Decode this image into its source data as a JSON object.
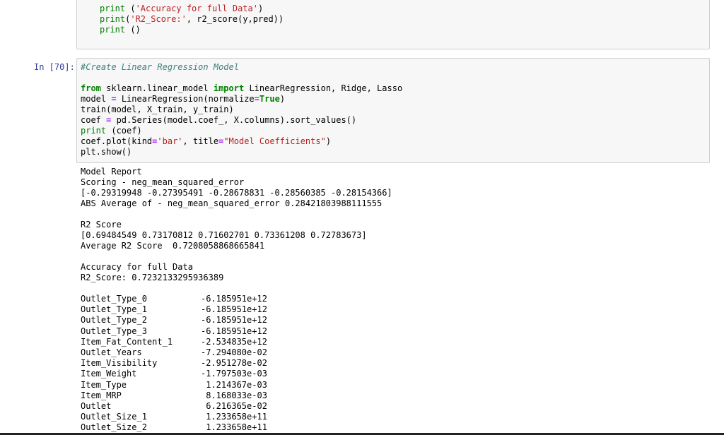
{
  "cell_prev": {
    "lines": [
      [
        {
          "t": "print",
          "c": "bi"
        },
        {
          "t": " (",
          "c": ""
        },
        {
          "t": "'Accuracy for full Data'",
          "c": "str"
        },
        {
          "t": ")",
          "c": ""
        }
      ],
      [
        {
          "t": "print",
          "c": "bi"
        },
        {
          "t": "(",
          "c": ""
        },
        {
          "t": "'R2_Score:'",
          "c": "str"
        },
        {
          "t": ", r2_score(y,pred))",
          "c": ""
        }
      ],
      [
        {
          "t": "print",
          "c": "bi"
        },
        {
          "t": " ()",
          "c": ""
        }
      ]
    ]
  },
  "cell70": {
    "prompt": "In [70]:",
    "lines": [
      [
        {
          "t": "#Create Linear Regression Model",
          "c": "cm"
        }
      ],
      [
        {
          "t": "",
          "c": ""
        }
      ],
      [
        {
          "t": "from",
          "c": "kw"
        },
        {
          "t": " sklearn.linear_model ",
          "c": ""
        },
        {
          "t": "import",
          "c": "kw"
        },
        {
          "t": " LinearRegression, Ridge, Lasso",
          "c": ""
        }
      ],
      [
        {
          "t": "model ",
          "c": ""
        },
        {
          "t": "=",
          "c": "op"
        },
        {
          "t": " LinearRegression(normalize",
          "c": ""
        },
        {
          "t": "=",
          "c": "op"
        },
        {
          "t": "True",
          "c": "kw"
        },
        {
          "t": ")",
          "c": ""
        }
      ],
      [
        {
          "t": "train(model, X_train, y_train)",
          "c": ""
        }
      ],
      [
        {
          "t": "coef ",
          "c": ""
        },
        {
          "t": "=",
          "c": "op"
        },
        {
          "t": " pd.Series(model.coef_, X.columns).sort_values()",
          "c": ""
        }
      ],
      [
        {
          "t": "print",
          "c": "bi"
        },
        {
          "t": " (coef)",
          "c": ""
        }
      ],
      [
        {
          "t": "coef.plot(kind",
          "c": ""
        },
        {
          "t": "=",
          "c": "op"
        },
        {
          "t": "'bar'",
          "c": "str"
        },
        {
          "t": ", title",
          "c": ""
        },
        {
          "t": "=",
          "c": "op"
        },
        {
          "t": "\"Model Coefficients\"",
          "c": "str"
        },
        {
          "t": ")",
          "c": ""
        }
      ],
      [
        {
          "t": "plt.show()",
          "c": ""
        }
      ]
    ]
  },
  "output": {
    "report_lines": [
      "Model Report",
      "Scoring - neg_mean_squared_error",
      "[-0.29319948 -0.27395491 -0.28678831 -0.28560385 -0.28154366]",
      "ABS Average of - neg_mean_squared_error 0.28421803988111555",
      "",
      "R2 Score",
      "[0.69484549 0.73170812 0.71602701 0.73361208 0.72783673]",
      "Average R2 Score  0.7208058868665841",
      "",
      "Accuracy for full Data",
      "R2_Score: 0.7232133295936389",
      ""
    ],
    "coefficients": [
      {
        "name": "Outlet_Type_0",
        "value": "-6.185951e+12"
      },
      {
        "name": "Outlet_Type_1",
        "value": "-6.185951e+12"
      },
      {
        "name": "Outlet_Type_2",
        "value": "-6.185951e+12"
      },
      {
        "name": "Outlet_Type_3",
        "value": "-6.185951e+12"
      },
      {
        "name": "Item_Fat_Content_1",
        "value": "-2.534835e+12"
      },
      {
        "name": "Outlet_Years",
        "value": "-7.294080e-02"
      },
      {
        "name": "Item_Visibility",
        "value": "-2.951278e-02"
      },
      {
        "name": "Item_Weight",
        "value": "-1.797503e-03"
      },
      {
        "name": "Item_Type",
        "value": " 1.214367e-03"
      },
      {
        "name": "Item_MRP",
        "value": " 8.168033e-03"
      },
      {
        "name": "Outlet",
        "value": " 6.216365e-02"
      },
      {
        "name": "Outlet_Size_1",
        "value": " 1.233658e+11"
      },
      {
        "name": "Outlet_Size_2",
        "value": " 1.233658e+11"
      }
    ]
  }
}
